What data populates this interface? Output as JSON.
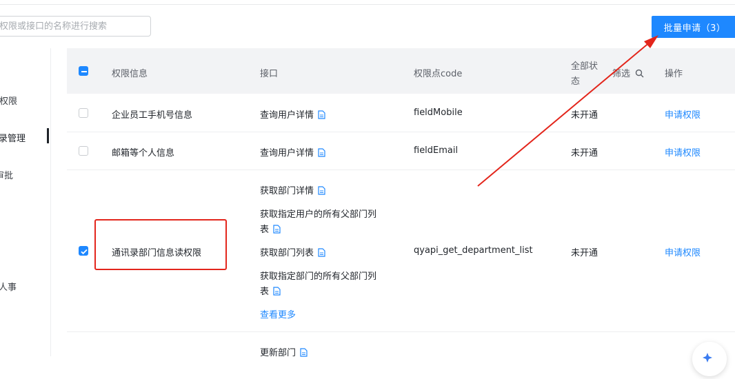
{
  "search": {
    "placeholder": "权限或接口的名称进行搜索"
  },
  "toolbar": {
    "batch_apply_label": "批量申请（3）"
  },
  "sidebar": {
    "items": [
      {
        "label": "权限"
      },
      {
        "label": "录管理"
      },
      {
        "label": "审批"
      },
      {
        "label": "人事"
      }
    ]
  },
  "table": {
    "headers": {
      "info": "权限信息",
      "api": "接口",
      "code": "权限点code",
      "status_line1": "全部状",
      "status_line2": "态",
      "filter": "筛选",
      "action": "操作"
    },
    "rows": [
      {
        "info": "企业员工手机号信息",
        "apis": [
          "查询用户详情"
        ],
        "code": "fieldMobile",
        "status": "未开通",
        "action": "申请权限",
        "checked": false
      },
      {
        "info": "邮箱等个人信息",
        "apis": [
          "查询用户详情"
        ],
        "code": "fieldEmail",
        "status": "未开通",
        "action": "申请权限",
        "checked": false
      },
      {
        "info": "通讯录部门信息读权限",
        "apis": [
          "获取部门详情",
          "获取指定用户的所有父部门列",
          "表",
          "获取部门列表",
          "获取指定部门的所有父部门列",
          "表"
        ],
        "more": "查看更多",
        "code": "qyapi_get_department_list",
        "status": "未开通",
        "action": "申请权限",
        "checked": true
      },
      {
        "apis": [
          "更新部门"
        ]
      }
    ]
  },
  "colors": {
    "accent": "#1e88ff",
    "highlight": "#e3251b"
  }
}
